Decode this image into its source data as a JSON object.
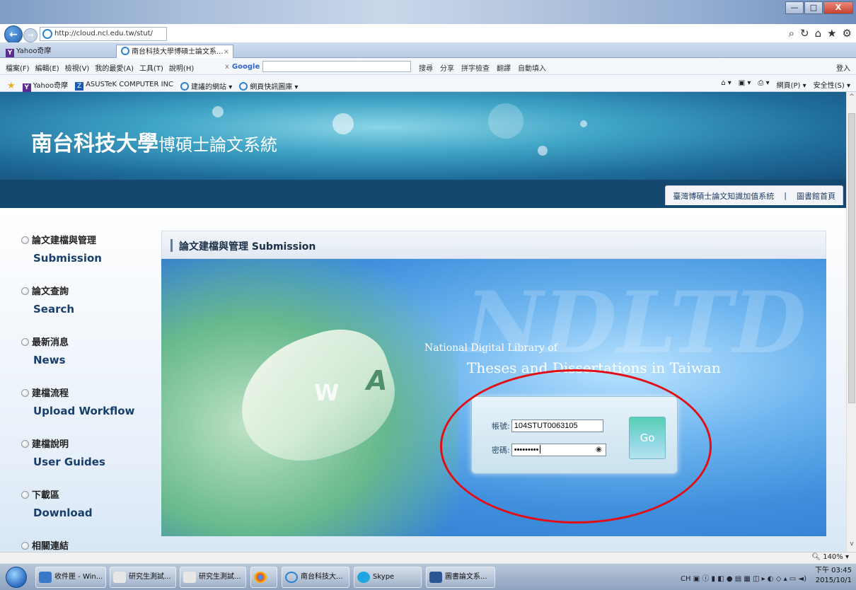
{
  "browser": {
    "window_buttons": {
      "minimize": "—",
      "maximize": "□",
      "close": "X"
    },
    "address": "http://cloud.ncl.edu.tw/stut/",
    "tabs": [
      {
        "label": "Yahoo奇摩"
      },
      {
        "label": "南台科技大學博碩士論文系...",
        "close": "×"
      }
    ],
    "menu": [
      "檔案(F)",
      "編輯(E)",
      "檢視(V)",
      "我的最愛(A)",
      "工具(T)",
      "說明(H)"
    ],
    "google": {
      "close": "x",
      "logo": "Google"
    },
    "google_tools": [
      "搜尋",
      "分享",
      "拼字檢查",
      "翻譯",
      "自動填入"
    ],
    "login_link": "登入",
    "favorites": [
      "Yahoo奇摩",
      "ASUSTeK COMPUTER INC",
      "建議的網站 ▾",
      "網頁快訊圖庫 ▾"
    ],
    "page_tools": [
      "網頁(P) ▾",
      "安全性(S) ▾"
    ],
    "zoom": "140%"
  },
  "site": {
    "title_big": "南台科技大學",
    "title_small": "博碩士論文系統",
    "top_links": [
      "臺灣博碩士論文知識加值系統",
      "|",
      "圖書館首頁"
    ],
    "sidebar": [
      {
        "zh": "論文建檔與管理",
        "en": "Submission"
      },
      {
        "zh": "論文查詢",
        "en": "Search"
      },
      {
        "zh": "最新消息",
        "en": "News"
      },
      {
        "zh": "建檔流程",
        "en": "Upload Workflow"
      },
      {
        "zh": "建檔說明",
        "en": "User Guides"
      },
      {
        "zh": "下載區",
        "en": "Download"
      },
      {
        "zh": "相關連結",
        "en": ""
      }
    ],
    "main_header": "論文建檔與管理 Submission",
    "hero": {
      "line1": "National Digital Library of",
      "line2": "Theses and Dissertations in Taiwan",
      "watermark": "NDLTD"
    },
    "login": {
      "account_label": "帳號:",
      "account_value": "104STUT0063105",
      "password_label": "密碼:",
      "password_value": "•••••••••",
      "go": "Go"
    }
  },
  "taskbar": {
    "items": [
      "收件匣 - Win...",
      "研究生測試...",
      "研究生測試...",
      "",
      "南台科技大...",
      "Skype",
      "圖書論文系..."
    ],
    "time": "下午 03:45",
    "date": "2015/10/1",
    "ime": "CH"
  },
  "colors": {
    "nav_blue": "#15486f",
    "ellipse_red": "#e10f15",
    "sidebar_en": "#183f6b"
  }
}
